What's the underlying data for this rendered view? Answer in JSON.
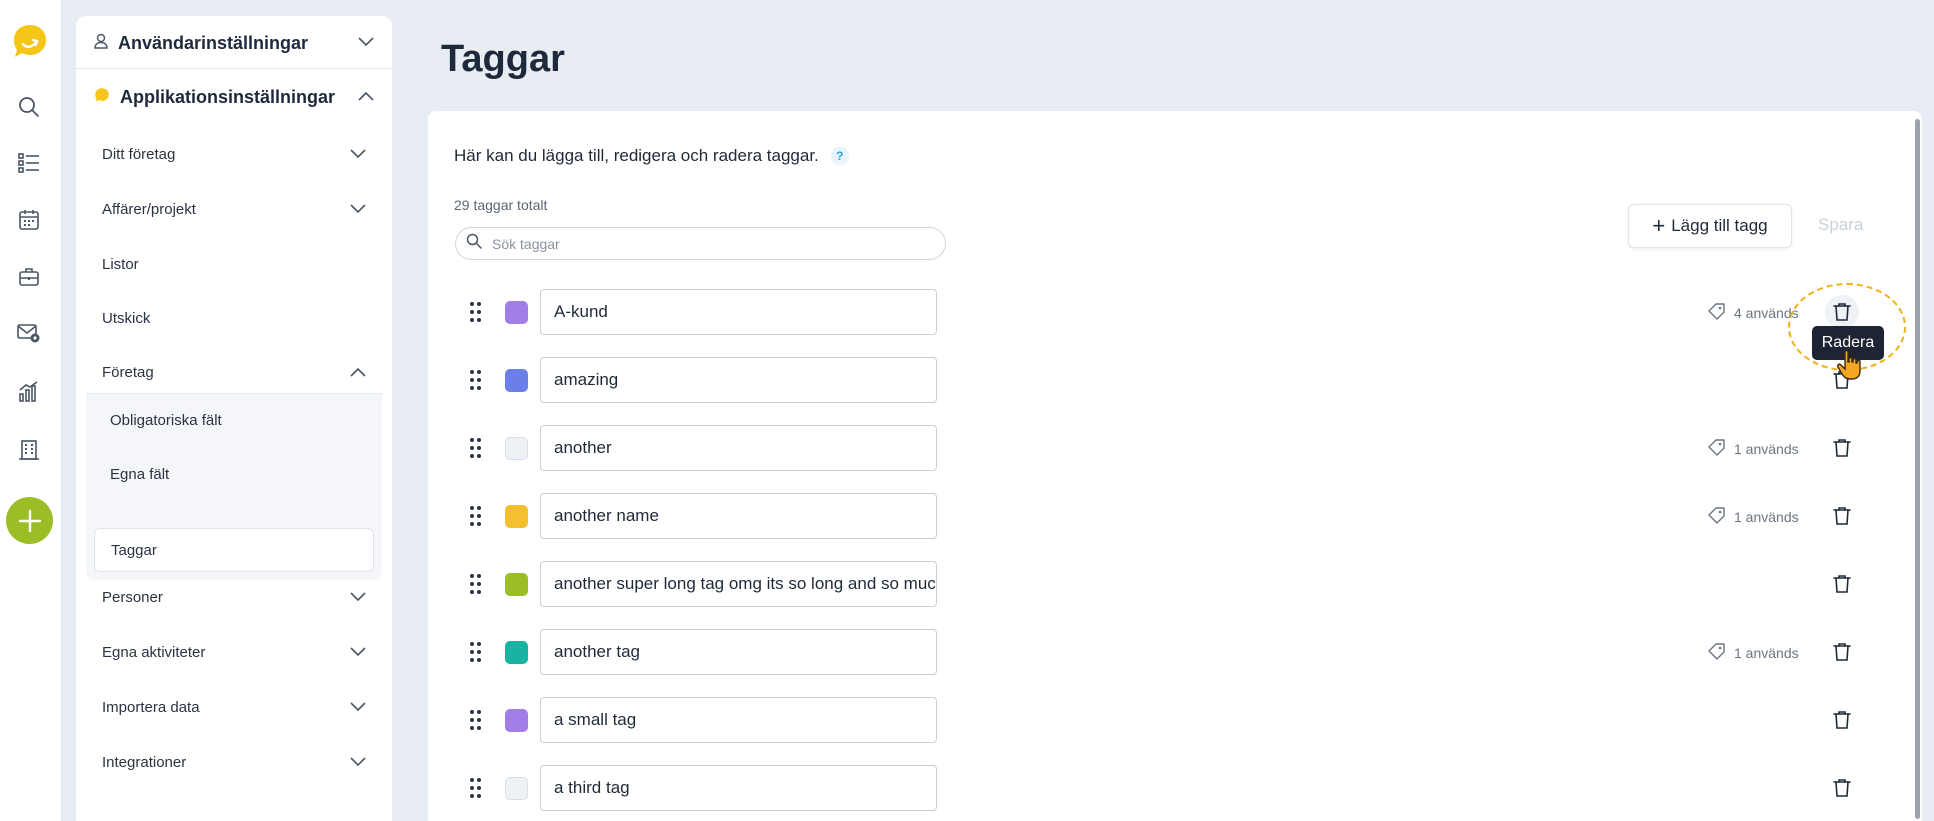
{
  "nav_rail": {
    "icons": [
      "logo-icon",
      "search-icon",
      "list-icon",
      "calendar-icon",
      "briefcase-icon",
      "mail-settings-icon",
      "chart-icon",
      "building-icon",
      "add-icon"
    ],
    "accent": "#9bbd26",
    "logo_color": "#f5c518"
  },
  "settings": {
    "user_section": "Användarinställningar",
    "app_section": "Applikationsinställningar",
    "items": [
      {
        "label": "Ditt företag"
      },
      {
        "label": "Affärer/projekt"
      },
      {
        "label": "Listor"
      },
      {
        "label": "Utskick"
      },
      {
        "label": "Företag"
      },
      {
        "label": "Personer"
      },
      {
        "label": "Egna aktiviteter"
      },
      {
        "label": "Importera data"
      },
      {
        "label": "Integrationer"
      }
    ],
    "foretag_sub": [
      {
        "label": "Obligatoriska fält"
      },
      {
        "label": "Egna fält"
      },
      {
        "label": "Taggar"
      }
    ]
  },
  "main": {
    "title": "Taggar",
    "description": "Här kan du lägga till, redigera och radera taggar.",
    "help": "?",
    "count": "29 taggar totalt",
    "search_placeholder": "Sök taggar",
    "add_button": "Lägg till tagg",
    "add_symbol": "+",
    "save_button": "Spara",
    "tooltip": "Radera",
    "tags": [
      {
        "name": "A-kund",
        "color": "#a27ee8",
        "usage": "4 används"
      },
      {
        "name": "amazing",
        "color": "#6b7fe8",
        "usage": ""
      },
      {
        "name": "another",
        "color": "",
        "usage": "1 används"
      },
      {
        "name": "another name",
        "color": "#f5c030",
        "usage": "1 används"
      },
      {
        "name": "another super long tag omg its so long and so much",
        "color": "#9bbd26",
        "usage": ""
      },
      {
        "name": "another tag",
        "color": "#17b3a3",
        "usage": "1 används"
      },
      {
        "name": "a small tag",
        "color": "#a27ee8",
        "usage": ""
      },
      {
        "name": "a third tag",
        "color": "",
        "usage": ""
      }
    ]
  }
}
